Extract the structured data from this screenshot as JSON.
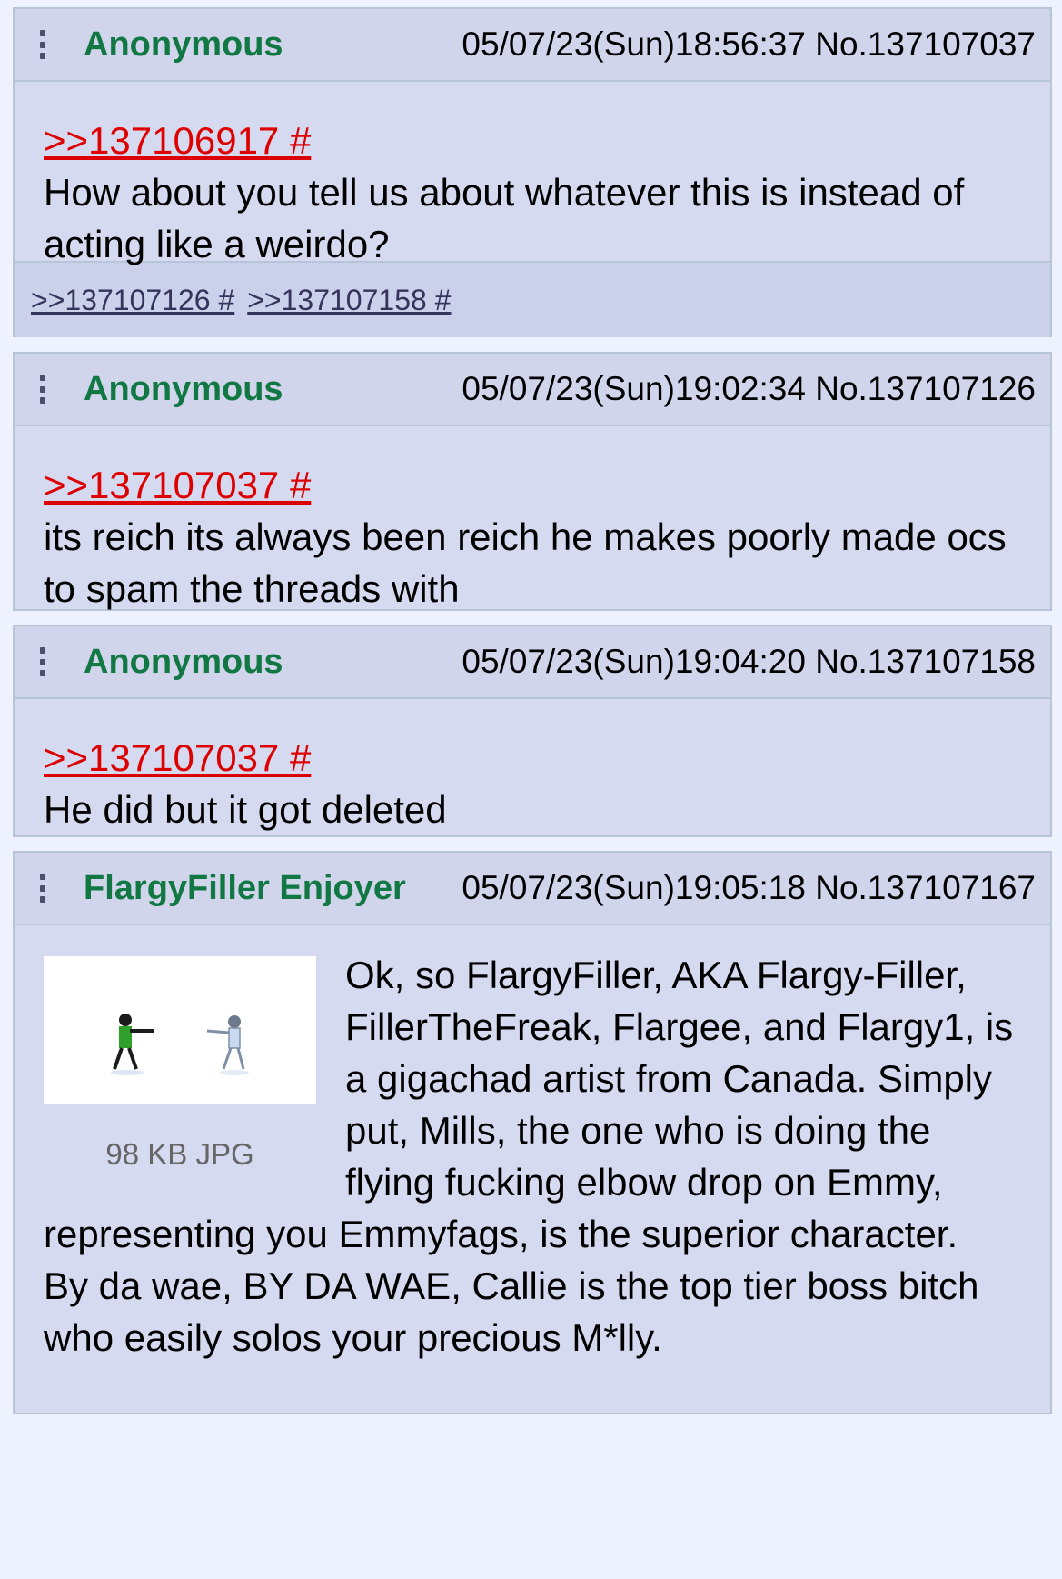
{
  "posts": [
    {
      "author": "Anonymous",
      "datetime": "05/07/23(Sun)18:56:37",
      "number": "No.137107037",
      "quote": ">>137106917 #",
      "text": "How about you tell us about whatever this is instead of acting like a weirdo?",
      "backlinks": [
        ">>137107126 #",
        ">>137107158 #"
      ]
    },
    {
      "author": "Anonymous",
      "datetime": "05/07/23(Sun)19:02:34",
      "number": "No.137107126",
      "quote": ">>137107037 #",
      "text": "its reich its always been reich he makes poorly made ocs to spam the threads with"
    },
    {
      "author": "Anonymous",
      "datetime": "05/07/23(Sun)19:04:20",
      "number": "No.137107158",
      "quote": ">>137107037 #",
      "text": "He did but it got deleted"
    },
    {
      "author": "FlargyFiller Enjoyer",
      "datetime": "05/07/23(Sun)19:05:18",
      "number": "No.137107167",
      "file_info": "98 KB JPG",
      "text_1": "Ok, so FlargyFiller, AKA Flargy-Filler, FillerTheFreak, Flargee, and Flargy1, is a gigachad artist from Canada. Simply put, Mills, the one who is doing the flying fucking elbow drop on Emmy, representing you Emmyfags, is the superior character.",
      "text_2": "By da wae, BY DA WAE, Callie is the top tier boss bitch who easily solos your precious M*lly."
    }
  ],
  "colors": {
    "post_bg": "#d6daf0",
    "border": "#b7c5d9",
    "author": "#117743",
    "quote_link": "#dd0000",
    "backlink": "#34345c"
  },
  "icons": [
    "menu-kebab-icon"
  ]
}
